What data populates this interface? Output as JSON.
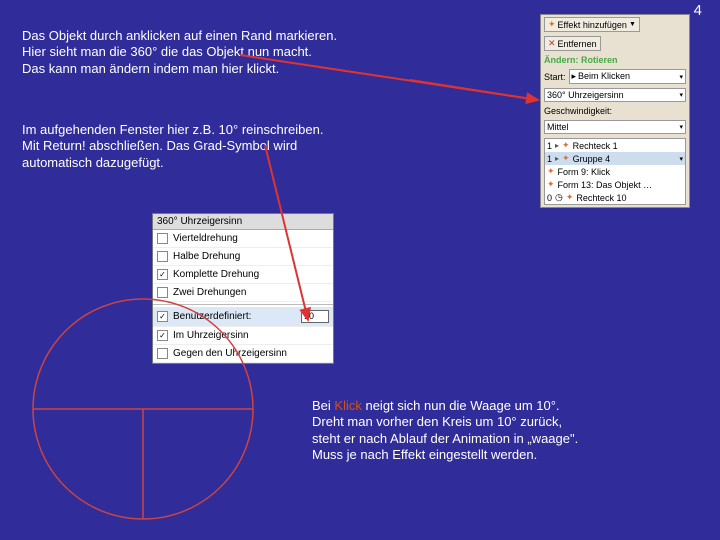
{
  "pageNumber": "4",
  "para1": {
    "l1": "Das Objekt durch anklicken auf einen Rand markieren.",
    "l2": "Hier sieht man die 360° die das Objekt nun macht.",
    "l3": "Das kann man ändern indem man hier klickt."
  },
  "para2": {
    "l1": "Im aufgehenden Fenster hier z.B. 10° reinschreiben.",
    "l2": "Mit Return! abschließen. Das Grad-Symbol wird",
    "l3": "automatisch dazugefügt."
  },
  "para3": {
    "pre": "Bei ",
    "klick": "Klick",
    "post": " neigt sich nun die Waage um 10°.",
    "l2": "Dreht man vorher den Kreis um 10° zurück,",
    "l3": "steht er nach Ablauf der Animation in „waage\".",
    "l4": "Muss je nach Effekt eingestellt werden."
  },
  "panel": {
    "addBtn": "Effekt hinzufügen",
    "removeBtn": "Entfernen",
    "changeHd": "Ändern: Rotieren",
    "startLabel": "Start:",
    "startVal": "Beim Klicken",
    "degVal": "360° Uhrzeigersinn",
    "speedLabel": "Geschwindigkeit:",
    "speedVal": "Mittel",
    "items": [
      {
        "n": "1",
        "label": "Rechteck 1"
      },
      {
        "n": "1",
        "label": "Gruppe 4"
      },
      {
        "n": "",
        "label": "Form 9: Klick"
      },
      {
        "n": "",
        "label": "Form 13: Das Objekt …"
      },
      {
        "n": "0",
        "label": "Rechteck 10"
      }
    ]
  },
  "rotmenu": {
    "title": "360° Uhrzeigersinn",
    "items": [
      "Vierteldrehung",
      "Halbe Drehung",
      "Komplette Drehung",
      "Zwei Drehungen",
      "Benutzerdefiniert:",
      "Im Uhrzeigersinn",
      "Gegen den Uhrzeigersinn"
    ],
    "checked": [
      2,
      4,
      5
    ],
    "customValue": "10"
  }
}
